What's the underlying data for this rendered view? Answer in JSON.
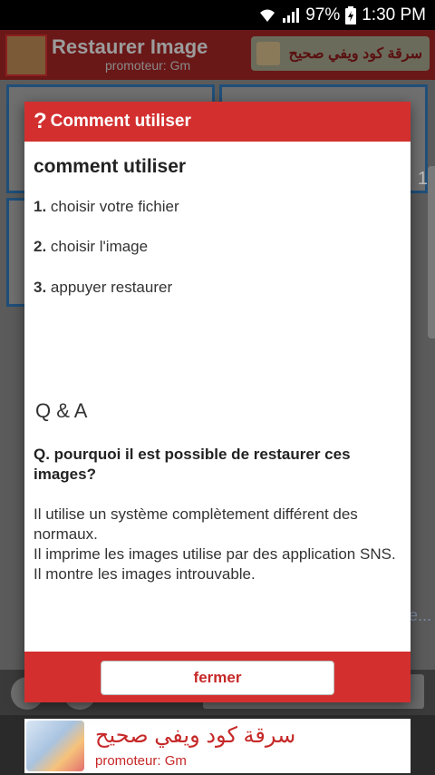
{
  "status_bar": {
    "battery": "97%",
    "time": "1:30 PM"
  },
  "app_header": {
    "title": "Restaurer Image",
    "promoter": "promoteur: Gm",
    "ad_text": "سرقة كود ويفي صحيح"
  },
  "background": {
    "thumb_count": "1",
    "ellipsis": "e..."
  },
  "dialog": {
    "title": "Comment utiliser",
    "heading": "comment utiliser",
    "steps": [
      {
        "num": "1.",
        "text": "choisir votre fichier"
      },
      {
        "num": "2.",
        "text": "choisir l'image"
      },
      {
        "num": "3.",
        "text": "appuyer restaurer"
      }
    ],
    "qa_title": "Q & A",
    "question": "Q. pourquoi il est possible de restaurer ces images?",
    "answer_lines": [
      "Il utilise un système complètement différent des normaux.",
      "Il imprime les images utilise par des application SNS.",
      "Il montre les images introuvable."
    ],
    "close_label": "fermer"
  },
  "ad_banner": {
    "title": "سرقة كود ويفي صحيح",
    "promoter": "promoteur: Gm"
  },
  "colors": {
    "accent": "#d32f2f",
    "text_red": "#c62828"
  },
  "icons": [
    "wifi-icon",
    "signal-icon",
    "battery-icon",
    "question-icon"
  ]
}
